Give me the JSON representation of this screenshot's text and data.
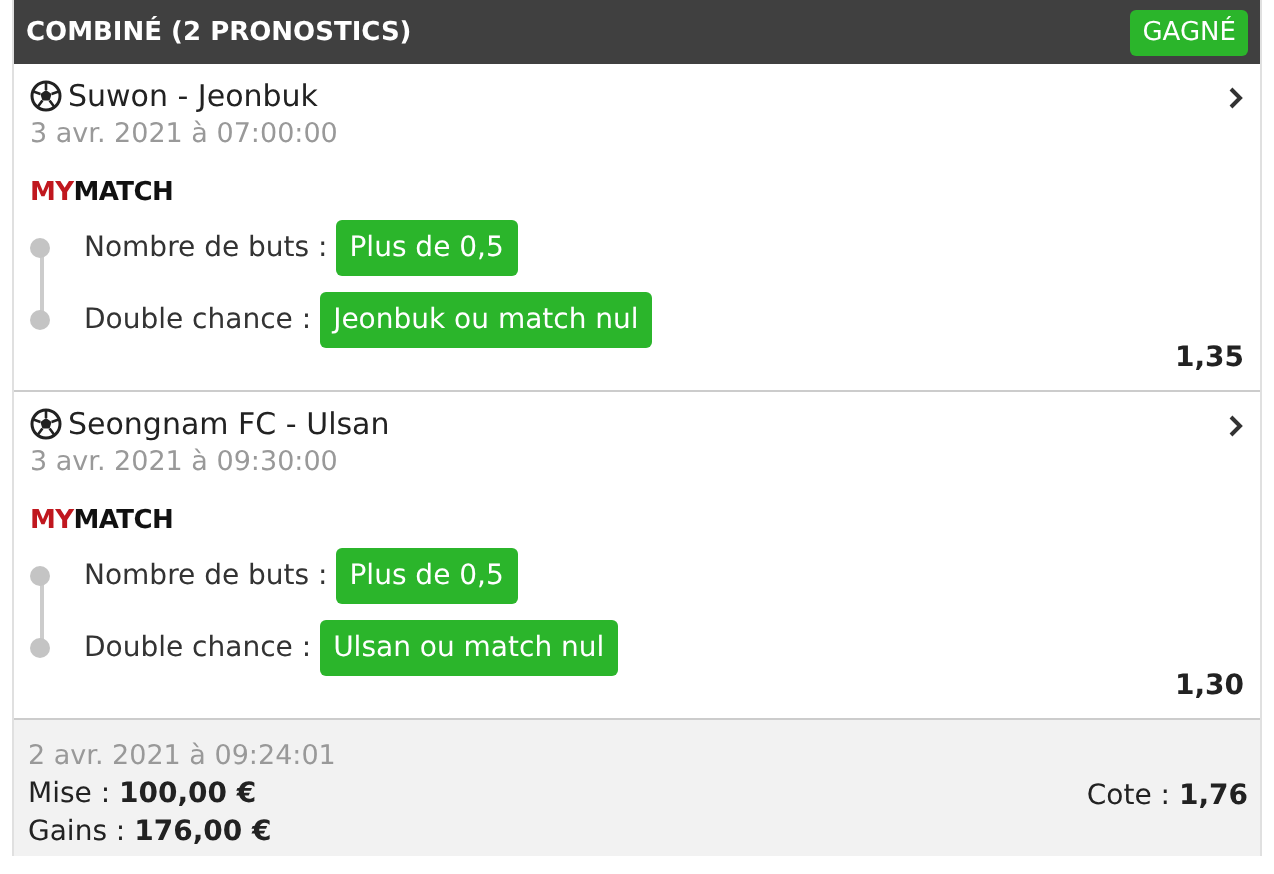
{
  "header": {
    "title": "COMBINÉ (2 PRONOSTICS)",
    "status": "GAGNÉ"
  },
  "matches": [
    {
      "teams": "Suwon - Jeonbuk",
      "date": "3 avr. 2021 à 07:00:00",
      "brand": {
        "accent": "MY",
        "rest": "MATCH"
      },
      "bets": [
        {
          "label": "Nombre de buts :",
          "pick": "Plus de 0,5"
        },
        {
          "label": "Double chance :",
          "pick": "Jeonbuk ou match nul"
        }
      ],
      "odds": "1,35"
    },
    {
      "teams": "Seongnam FC - Ulsan",
      "date": "3 avr. 2021 à 09:30:00",
      "brand": {
        "accent": "MY",
        "rest": "MATCH"
      },
      "bets": [
        {
          "label": "Nombre de buts :",
          "pick": "Plus de 0,5"
        },
        {
          "label": "Double chance :",
          "pick": "Ulsan ou match nul"
        }
      ],
      "odds": "1,30"
    }
  ],
  "footer": {
    "date": "2 avr. 2021 à 09:24:01",
    "stake": "Mise : **100,00 €**",
    "winnings": "Gains : **176,00 €**",
    "odds": "Cote : **1,76**"
  }
}
